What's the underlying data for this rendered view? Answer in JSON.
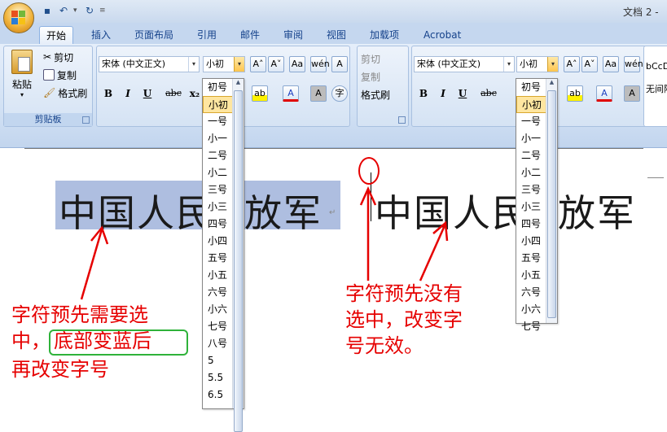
{
  "window": {
    "title": "文档 2 -"
  },
  "quick_access": {
    "save_icon": "save-icon",
    "undo_icon": "undo-icon",
    "redo_icon": "redo-icon"
  },
  "tabs": [
    {
      "label": "开始"
    },
    {
      "label": "插入"
    },
    {
      "label": "页面布局"
    },
    {
      "label": "引用"
    },
    {
      "label": "邮件"
    },
    {
      "label": "审阅"
    },
    {
      "label": "视图"
    },
    {
      "label": "加载项"
    },
    {
      "label": "Acrobat"
    }
  ],
  "clipboard": {
    "paste_label": "粘贴",
    "cut_label": "剪切",
    "copy_label": "复制",
    "format_painter_label": "格式刷",
    "group_label": "剪贴板"
  },
  "font_left": {
    "font_name": "宋体 (中文正文)",
    "font_size": "小初"
  },
  "font_right": {
    "font_name": "宋体 (中文正文)",
    "font_size": "小初"
  },
  "clipboard_right": {
    "cut_label": "剪切",
    "copy_label": "复制",
    "format_painter_label": "格式刷"
  },
  "styles_preview": {
    "sample": "bCcD",
    "caption": "无间隔"
  },
  "size_list_left": [
    "初号",
    "小初",
    "一号",
    "小一",
    "二号",
    "小二",
    "三号",
    "小三",
    "四号",
    "小四",
    "五号",
    "小五",
    "六号",
    "小六",
    "七号",
    "八号",
    "5",
    "5.5",
    "6.5"
  ],
  "size_list_right": [
    "初号",
    "小初",
    "一号",
    "小一",
    "二号",
    "小二",
    "三号",
    "小三",
    "四号",
    "小四",
    "五号",
    "小五",
    "六号",
    "小六",
    "七号"
  ],
  "document": {
    "text_left": "中国人民",
    "text_left_tail": "放军",
    "text_right": "中国人民",
    "text_right_tail": "放军"
  },
  "annotations": {
    "left_line1": "字符预先需要选",
    "left_line2_a": "中，",
    "left_line2_b": "底部变蓝后",
    "left_line3": "再改变字号",
    "right_line1": "字符预先没有",
    "right_line2": "选中，改变字",
    "right_line3": "号无效。"
  },
  "colors": {
    "annotation_red": "#e60000",
    "highlight_green": "#2fb23a",
    "selection_blue": "#aebee0"
  }
}
